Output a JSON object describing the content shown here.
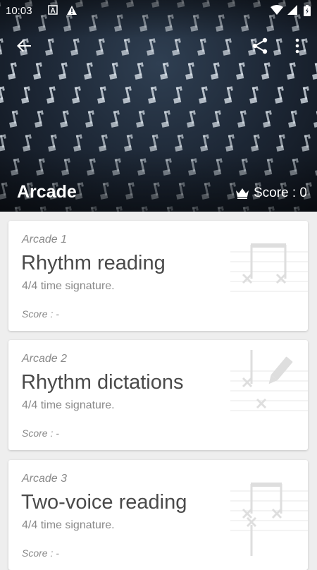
{
  "status_bar": {
    "time": "10:03"
  },
  "header": {
    "title": "Arcade",
    "score_label": "Score : 0"
  },
  "icons": {
    "back": "arrow-back-icon",
    "share": "share-icon",
    "more": "more-vert-icon",
    "crown": "crown-icon"
  },
  "cards": [
    {
      "subtitle": "Arcade 1",
      "title": "Rhythm reading",
      "description": "4/4 time signature.",
      "score": "Score : -"
    },
    {
      "subtitle": "Arcade 2",
      "title": "Rhythm dictations",
      "description": "4/4 time signature.",
      "score": "Score : -"
    },
    {
      "subtitle": "Arcade 3",
      "title": "Two-voice reading",
      "description": "4/4 time signature.",
      "score": "Score : -"
    }
  ]
}
